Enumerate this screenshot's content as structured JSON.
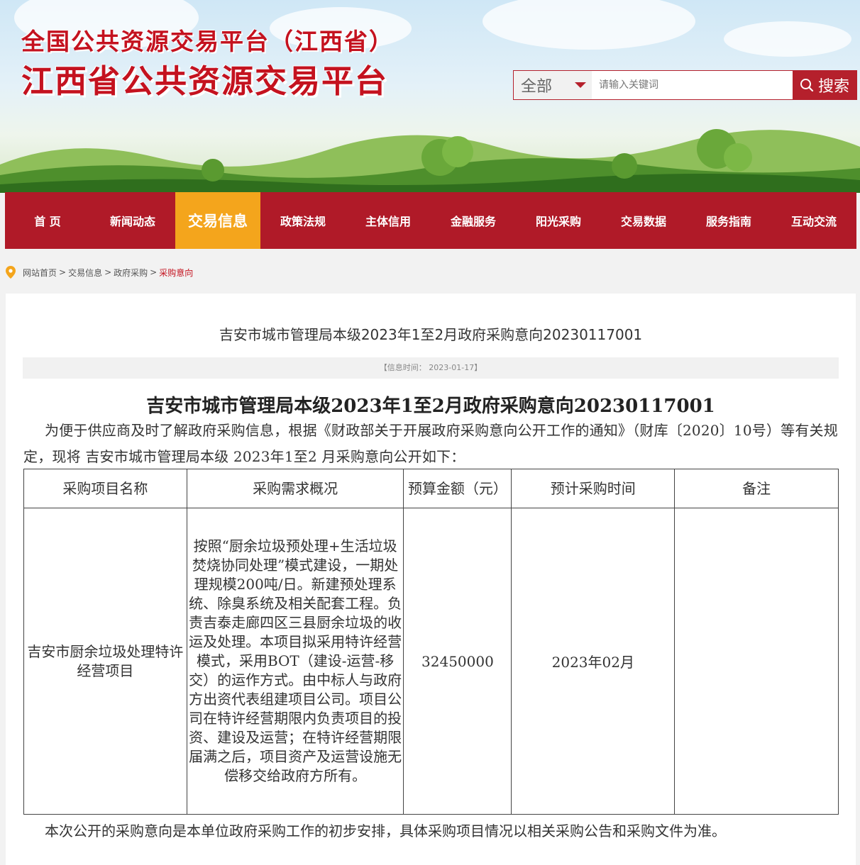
{
  "header": {
    "logo_line1": "全国公共资源交易平台（江西省）",
    "logo_line2": "江西省公共资源交易平台"
  },
  "search": {
    "category": "全部",
    "placeholder": "请输入关键词",
    "button_label": "搜索"
  },
  "nav": {
    "items": [
      {
        "label": "首 页"
      },
      {
        "label": "新闻动态"
      },
      {
        "label": "交易信息"
      },
      {
        "label": "政策法规"
      },
      {
        "label": "主体信用"
      },
      {
        "label": "金融服务"
      },
      {
        "label": "阳光采购"
      },
      {
        "label": "交易数据"
      },
      {
        "label": "服务指南"
      },
      {
        "label": "互动交流"
      }
    ],
    "active_index": 2
  },
  "breadcrumb": {
    "items": [
      "网站首页",
      "交易信息",
      "政府采购",
      "采购意向"
    ],
    "separator": ">"
  },
  "article": {
    "title": "吉安市城市管理局本级2023年1至2月政府采购意向20230117001",
    "info_time": "【信息时间：  2023-01-17】",
    "doc_title": "吉安市城市管理局本级2023年1至2月政府采购意向20230117001",
    "intro": "为便于供应商及时了解政府采购信息，根据《财政部关于开展政府采购意向公开工作的通知》（财库〔2020〕10号）等有关规定，现将 吉安市城市管理局本级 2023年1至2 月采购意向公开如下：",
    "table": {
      "headers": [
        "采购项目名称",
        "采购需求概况",
        "预算金额（元）",
        "预计采购时间",
        "备注"
      ],
      "rows": [
        {
          "name": "吉安市厨余垃圾处理特许经营项目",
          "requirement": "按照“厨余垃圾预处理+生活垃圾焚烧协同处理”模式建设，一期处理规模200吨/日。新建预处理系统、除臭系统及相关配套工程。负责吉泰走廊四区三县厨余垃圾的收运及处理。本项目拟采用特许经营模式，采用BOT（建设-运营-移交）的运作方式。由中标人与政府方出资代表组建项目公司。项目公司在特许经营期限内负责项目的投资、建设及运营；在特许经营期限届满之后，项目资产及运营设施无偿移交给政府方所有。",
          "budget": "32450000",
          "time": "2023年02月",
          "remark": ""
        }
      ]
    },
    "footer": "本次公开的采购意向是本单位政府采购工作的初步安排，具体采购项目情况以相关采购公告和采购文件为准。"
  },
  "colors": {
    "brand_red": "#b01a28",
    "nav_active": "#f4a51c",
    "breadcrumb_current": "#c4121f"
  }
}
